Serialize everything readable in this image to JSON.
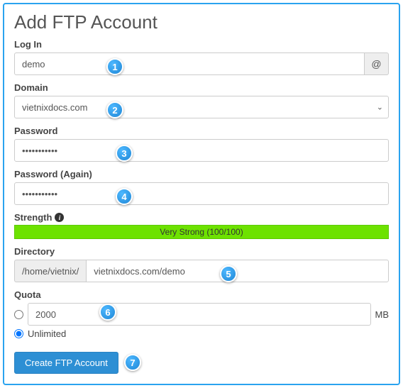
{
  "page": {
    "title": "Add FTP Account"
  },
  "login": {
    "label": "Log In",
    "value": "demo",
    "addon": "@"
  },
  "domain": {
    "label": "Domain",
    "value": "vietnixdocs.com"
  },
  "password": {
    "label": "Password",
    "value": "•••••••••••"
  },
  "password_again": {
    "label": "Password (Again)",
    "value": "•••••••••••"
  },
  "strength": {
    "label": "Strength",
    "bar_text": "Very Strong (100/100)"
  },
  "directory": {
    "label": "Directory",
    "prefix": "/home/vietnix/",
    "value": "vietnixdocs.com/demo"
  },
  "quota": {
    "label": "Quota",
    "mb_value": "2000",
    "mb_unit": "MB",
    "unlimited_label": "Unlimited"
  },
  "submit": {
    "label": "Create FTP Account"
  },
  "callouts": [
    "1",
    "2",
    "3",
    "4",
    "5",
    "6",
    "7"
  ]
}
